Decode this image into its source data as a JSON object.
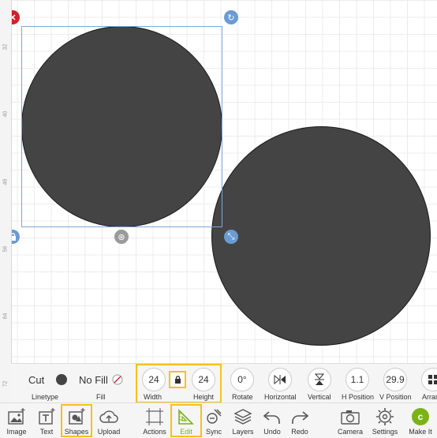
{
  "ruler": {
    "labels": [
      "32",
      "40",
      "48",
      "56",
      "64",
      "72"
    ]
  },
  "linetype": {
    "value": "Cut",
    "label": "Linetype"
  },
  "fill": {
    "value": "No Fill",
    "label": "Fill"
  },
  "size": {
    "width": "24",
    "width_label": "Width",
    "height": "24",
    "height_label": "Height"
  },
  "rotate": {
    "value": "0°",
    "label": "Rotate"
  },
  "flip": {
    "horizontal_label": "Horizontal",
    "vertical_label": "Vertical"
  },
  "position": {
    "h": "1.1",
    "h_label": "H Position",
    "v": "29.9",
    "v_label": "V Position"
  },
  "arrange": {
    "label": "Arran"
  },
  "toolbar": {
    "image": "Image",
    "text": "Text",
    "shapes": "Shapes",
    "upload": "Upload",
    "actions": "Actions",
    "edit": "Edit",
    "sync": "Sync",
    "layers": "Layers",
    "undo": "Undo",
    "redo": "Redo",
    "camera": "Camera",
    "settings": "Settings",
    "make_it": "Make It"
  },
  "colors": {
    "shape": "#444444",
    "highlight": "#f5c11b",
    "accent_green": "#7ab317",
    "handle_blue": "#6a9bd4",
    "delete_red": "#d0202c"
  }
}
